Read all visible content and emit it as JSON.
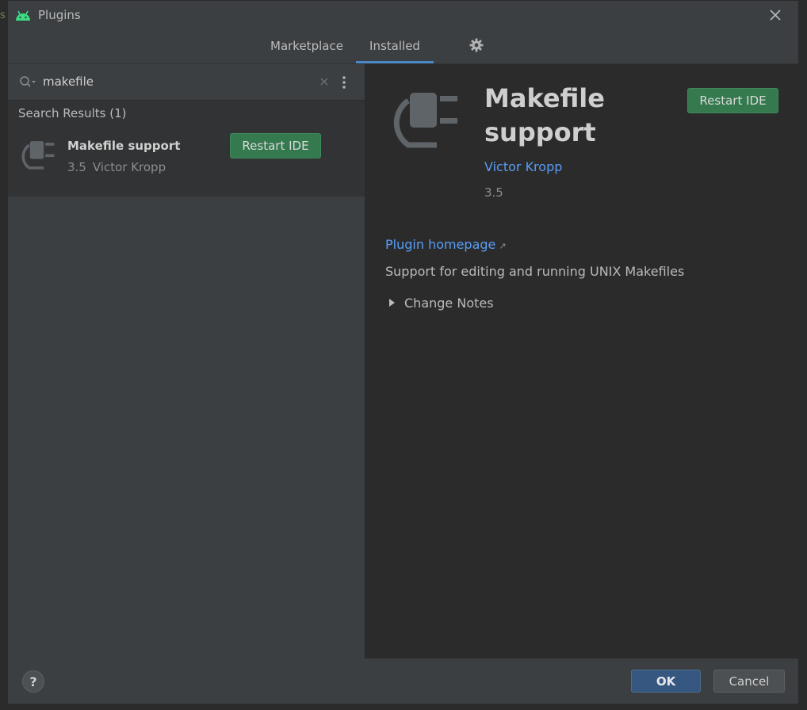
{
  "window": {
    "title": "Plugins",
    "icon": "android-icon",
    "close_icon": "close-icon"
  },
  "background_edge_text": "s",
  "tabs": [
    {
      "label": "Marketplace",
      "active": false
    },
    {
      "label": "Installed",
      "active": true
    }
  ],
  "settings_icon": "gear-icon",
  "search": {
    "value": "makefile",
    "icon": "search-icon",
    "clear_icon": "clear-icon",
    "menu_icon": "kebab-menu-icon"
  },
  "results": {
    "header": "Search Results (1)",
    "items": [
      {
        "name": "Makefile support",
        "version": "3.5",
        "author": "Victor Kropp",
        "button": "Restart IDE",
        "icon": "plugin-plug-icon"
      }
    ]
  },
  "detail": {
    "title": "Makefile support",
    "author": "Victor Kropp",
    "version": "3.5",
    "button": "Restart IDE",
    "homepage_label": "Plugin homepage",
    "homepage_ext_glyph": "↗",
    "description": "Support for editing and running UNIX Makefiles",
    "change_notes_label": "Change Notes",
    "icon": "plugin-plug-icon"
  },
  "footer": {
    "help": "?",
    "ok": "OK",
    "cancel": "Cancel"
  },
  "colors": {
    "accent": "#4a88c7",
    "link": "#589df6",
    "button_green": "#357a4f",
    "ok_blue": "#365880",
    "android_green": "#3ddc84"
  }
}
